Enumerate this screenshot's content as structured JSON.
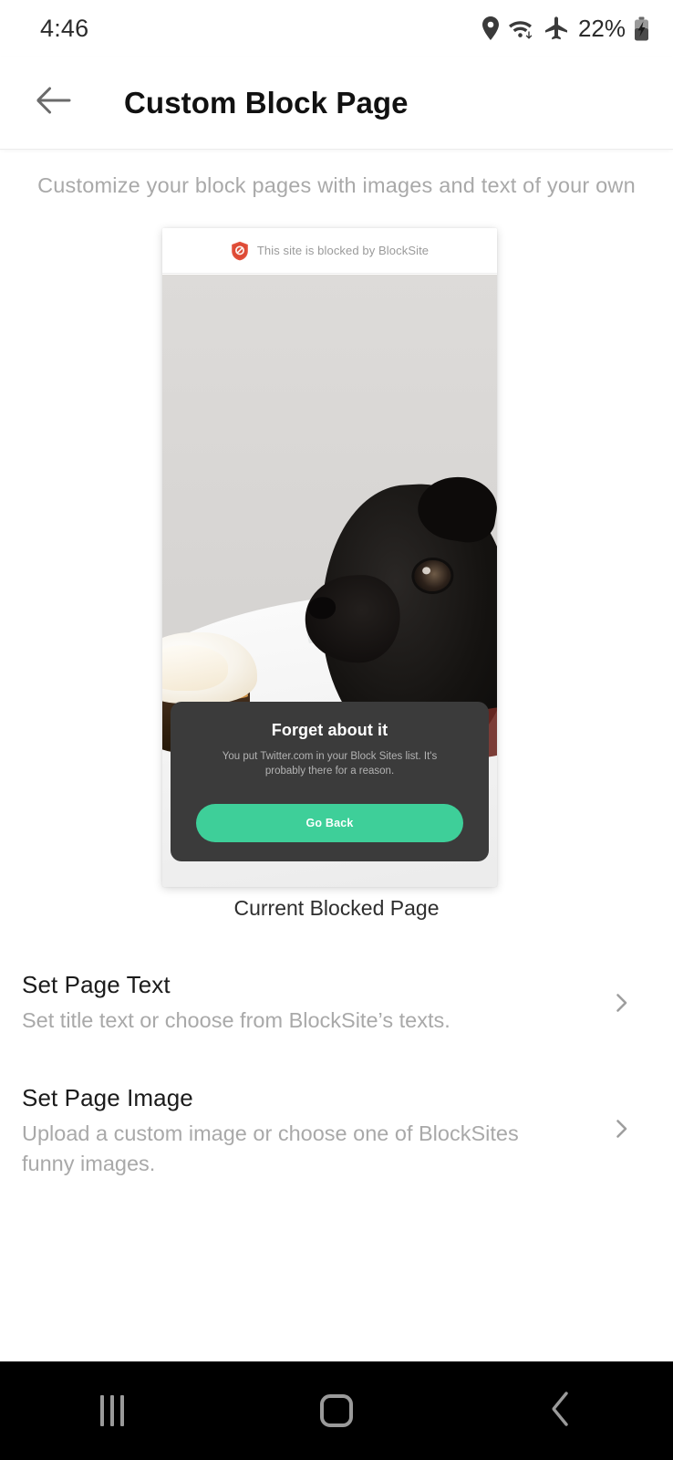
{
  "status_bar": {
    "time": "4:46",
    "battery_percent": "22%",
    "icons": [
      "location-pin-icon",
      "wifi-icon",
      "airplane-mode-icon",
      "battery-charging-icon"
    ]
  },
  "app_bar": {
    "back_icon": "arrow-left-icon",
    "title": "Custom Block Page"
  },
  "subtitle": "Customize your block pages with images and text of your own",
  "preview": {
    "browser_bar": {
      "icon": "blocksite-shield-icon",
      "text": "This site is blocked by BlockSite"
    },
    "block_card": {
      "title": "Forget about it",
      "body": "You put Twitter.com in your Block Sites list. It's probably there for a reason.",
      "button_label": "Go Back"
    },
    "caption": "Current Blocked Page"
  },
  "settings_rows": [
    {
      "title": "Set Page Text",
      "subtitle": "Set title text or choose from BlockSite’s texts.",
      "chevron": "chevron-right-icon"
    },
    {
      "title": "Set Page Image",
      "subtitle": "Upload a custom image or choose one of BlockSites funny images.",
      "chevron": "chevron-right-icon"
    }
  ],
  "nav_bar": {
    "recents": "recents-icon",
    "home": "home-icon",
    "back": "back-icon"
  },
  "colors": {
    "accent_green": "#3ecf99",
    "shield_red": "#e2513c",
    "card_dark": "#3b3b3b",
    "muted_text": "#a9a9a9"
  }
}
